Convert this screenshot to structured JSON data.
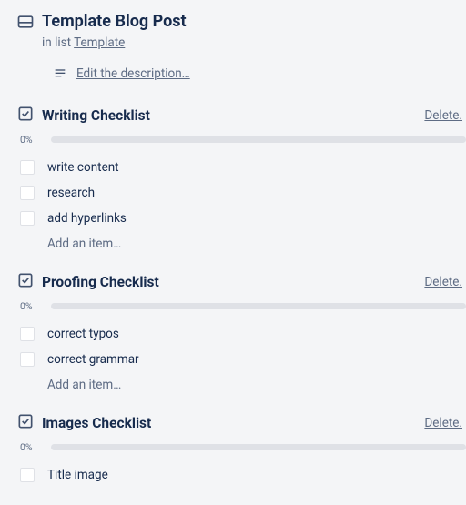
{
  "header": {
    "title": "Template Blog Post",
    "in_list_prefix": "in list ",
    "list_name": "Template",
    "edit_description": "Edit the description…"
  },
  "delete_label": "Delete.",
  "add_item_label": "Add an item…",
  "checklists": [
    {
      "title": "Writing Checklist",
      "progress": "0%",
      "items": [
        "write content",
        "research",
        "add hyperlinks"
      ]
    },
    {
      "title": "Proofing Checklist",
      "progress": "0%",
      "items": [
        "correct typos",
        "correct grammar"
      ]
    },
    {
      "title": "Images Checklist",
      "progress": "0%",
      "items": [
        "Title image"
      ]
    }
  ]
}
